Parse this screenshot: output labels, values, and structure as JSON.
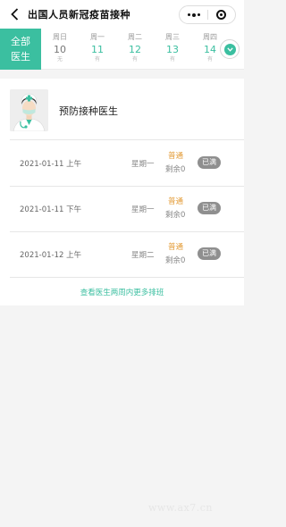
{
  "header": {
    "title": "出国人员新冠疫苗接种"
  },
  "date_bar": {
    "all_label_line1": "全部",
    "all_label_line2": "医生",
    "days": [
      {
        "weekday": "周日",
        "date": "10",
        "status": "无"
      },
      {
        "weekday": "周一",
        "date": "11",
        "status": "有"
      },
      {
        "weekday": "周二",
        "date": "12",
        "status": "有"
      },
      {
        "weekday": "周三",
        "date": "13",
        "status": "有"
      },
      {
        "weekday": "周四",
        "date": "14",
        "status": "有"
      }
    ]
  },
  "doctor": {
    "name": "预防接种医生",
    "slots": [
      {
        "date": "2021-01-11 上午",
        "weekday": "星期一",
        "type": "普通",
        "remain": "剩余0",
        "status": "已满"
      },
      {
        "date": "2021-01-11 下午",
        "weekday": "星期一",
        "type": "普通",
        "remain": "剩余0",
        "status": "已满"
      },
      {
        "date": "2021-01-12 上午",
        "weekday": "星期二",
        "type": "普通",
        "remain": "剩余0",
        "status": "已满"
      }
    ],
    "more_link": "查看医生两周内更多排班"
  },
  "watermark": "www.ax7.cn",
  "colors": {
    "accent": "#3bbfa0",
    "orange": "#e39b36",
    "badge": "#8f8f8f"
  }
}
